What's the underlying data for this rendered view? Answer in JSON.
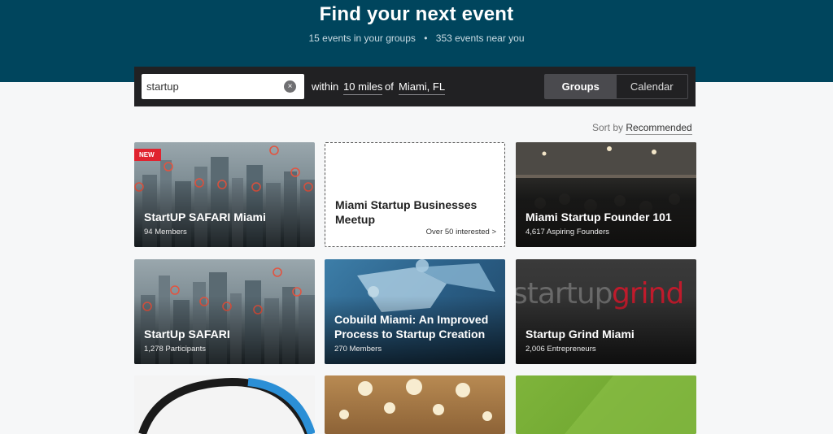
{
  "hero": {
    "title": "Find your next event",
    "groups_stat": "15 events in your groups",
    "separator": "•",
    "near_stat": "353 events near you"
  },
  "filter": {
    "search_value": "startup",
    "clear_icon": "×",
    "within_label": "within",
    "distance": "10 miles",
    "of_label": "of",
    "location": "Miami, FL",
    "view_options": [
      "Groups",
      "Calendar"
    ],
    "active_view": "Groups"
  },
  "sort": {
    "label": "Sort by",
    "value": "Recommended"
  },
  "cards": [
    {
      "title": "StartUP SAFARI Miami",
      "meta": "94 Members",
      "badge": "NEW"
    },
    {
      "title": "Miami Startup Businesses Meetup",
      "interest": "Over 50 interested >"
    },
    {
      "title": "Miami Startup Founder 101",
      "meta": "4,617 Aspiring Founders"
    },
    {
      "title": "StartUp SAFARI",
      "meta": "1,278 Participants"
    },
    {
      "title": "Cobuild Miami: An Improved Process to Startup Creation",
      "meta": "270 Members"
    },
    {
      "title": "Startup Grind Miami",
      "meta": "2,006 Entrepreneurs",
      "logo_left": "startup",
      "logo_right": "grind"
    }
  ],
  "colors": {
    "hero_bg": "#00455d",
    "filter_bg": "#212123",
    "badge_red": "#e0232f",
    "grind_red": "#c01b2c"
  }
}
